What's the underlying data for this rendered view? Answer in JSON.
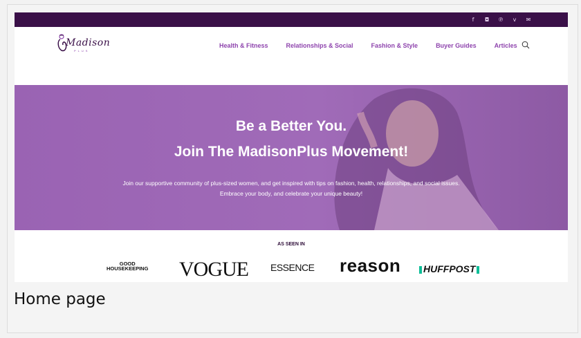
{
  "topbar": {
    "icons": [
      "facebook-icon",
      "instagram-icon",
      "pinterest-icon",
      "vimeo-icon",
      "email-icon"
    ],
    "glyphs": [
      "f",
      "◘",
      "℗",
      "v",
      "✉"
    ]
  },
  "brand": {
    "logo_text": "Madison",
    "logo_sub": "PLUS"
  },
  "nav": {
    "items": [
      "Health & Fitness",
      "Relationships & Social",
      "Fashion & Style",
      "Buyer Guides",
      "Articles"
    ]
  },
  "hero": {
    "line1": "Be a Better You.",
    "line2": "Join The MadisonPlus Movement!",
    "para1": "Join our supportive community of plus-sized women, and get inspired with tips on fashion, health, relationships, and social issues.",
    "para2": "Embrace your body, and celebrate your unique beauty!"
  },
  "seen": {
    "title": "AS SEEN IN",
    "brands": {
      "gh_top": "GOOD",
      "gh_bottom": "HOUSEKEEPING",
      "vogue": "VOGUE",
      "essence": "ESSENCE",
      "reason": "reason",
      "huffpost": "HUFFPOST"
    }
  },
  "caption": "Home page",
  "colors": {
    "accent": "#8e44ad",
    "topbar": "#3a1048",
    "hero": "#a06bb8"
  }
}
